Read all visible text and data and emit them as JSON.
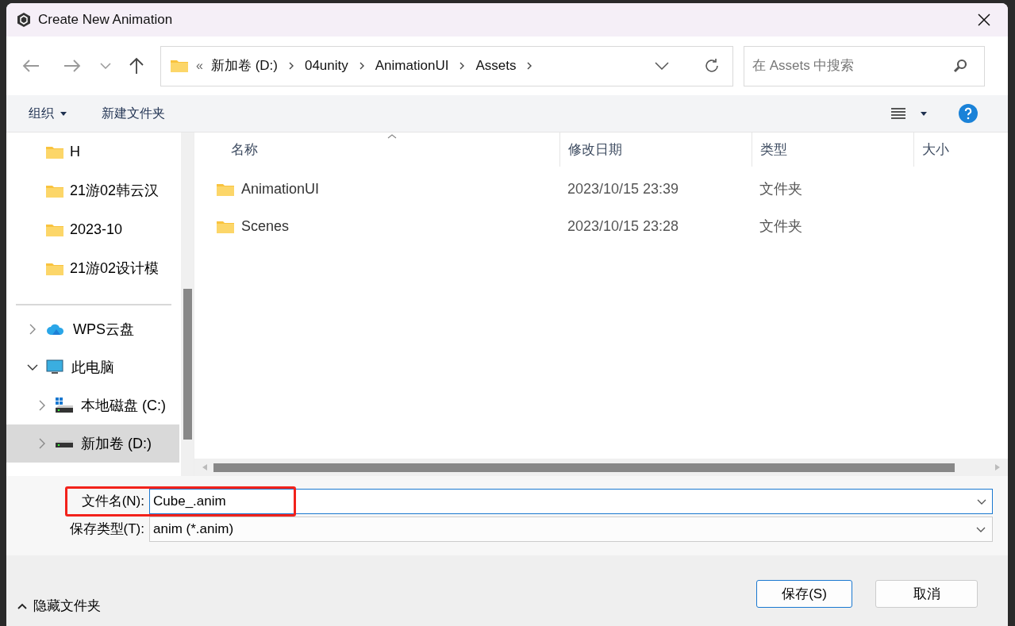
{
  "window": {
    "title": "Create New Animation"
  },
  "address_bar": {
    "overflow": "«",
    "segments": [
      "新加卷 (D:)",
      "04unity",
      "AnimationUI",
      "Assets"
    ]
  },
  "search": {
    "placeholder": "在 Assets 中搜索"
  },
  "toolbar": {
    "organize": "组织",
    "new_folder": "新建文件夹"
  },
  "sidebar": {
    "quick_access": [
      {
        "label": "H"
      },
      {
        "label": "21游02韩云汉"
      },
      {
        "label": "2023-10"
      },
      {
        "label": "21游02设计模"
      }
    ],
    "tree": [
      {
        "label": "WPS云盘",
        "kind": "cloud",
        "expanded": false,
        "selected": false
      },
      {
        "label": "此电脑",
        "kind": "computer",
        "expanded": true,
        "selected": false,
        "children": [
          {
            "label": "本地磁盘 (C:)",
            "kind": "system-drive",
            "expanded": false,
            "selected": false
          },
          {
            "label": "新加卷 (D:)",
            "kind": "drive",
            "expanded": false,
            "selected": true
          }
        ]
      }
    ]
  },
  "table": {
    "columns": [
      "名称",
      "修改日期",
      "类型",
      "大小"
    ],
    "rows": [
      {
        "name": "AnimationUI",
        "modified": "2023/10/15 23:39",
        "type": "文件夹"
      },
      {
        "name": "Scenes",
        "modified": "2023/10/15 23:28",
        "type": "文件夹"
      }
    ]
  },
  "form": {
    "filename_label": "文件名(N):",
    "filename": "Cube_.anim",
    "filetype_label": "保存类型(T):",
    "filetype": "anim (*.anim)"
  },
  "footer": {
    "hide_folders": "隐藏文件夹",
    "save": "保存(S)",
    "cancel": "取消"
  }
}
